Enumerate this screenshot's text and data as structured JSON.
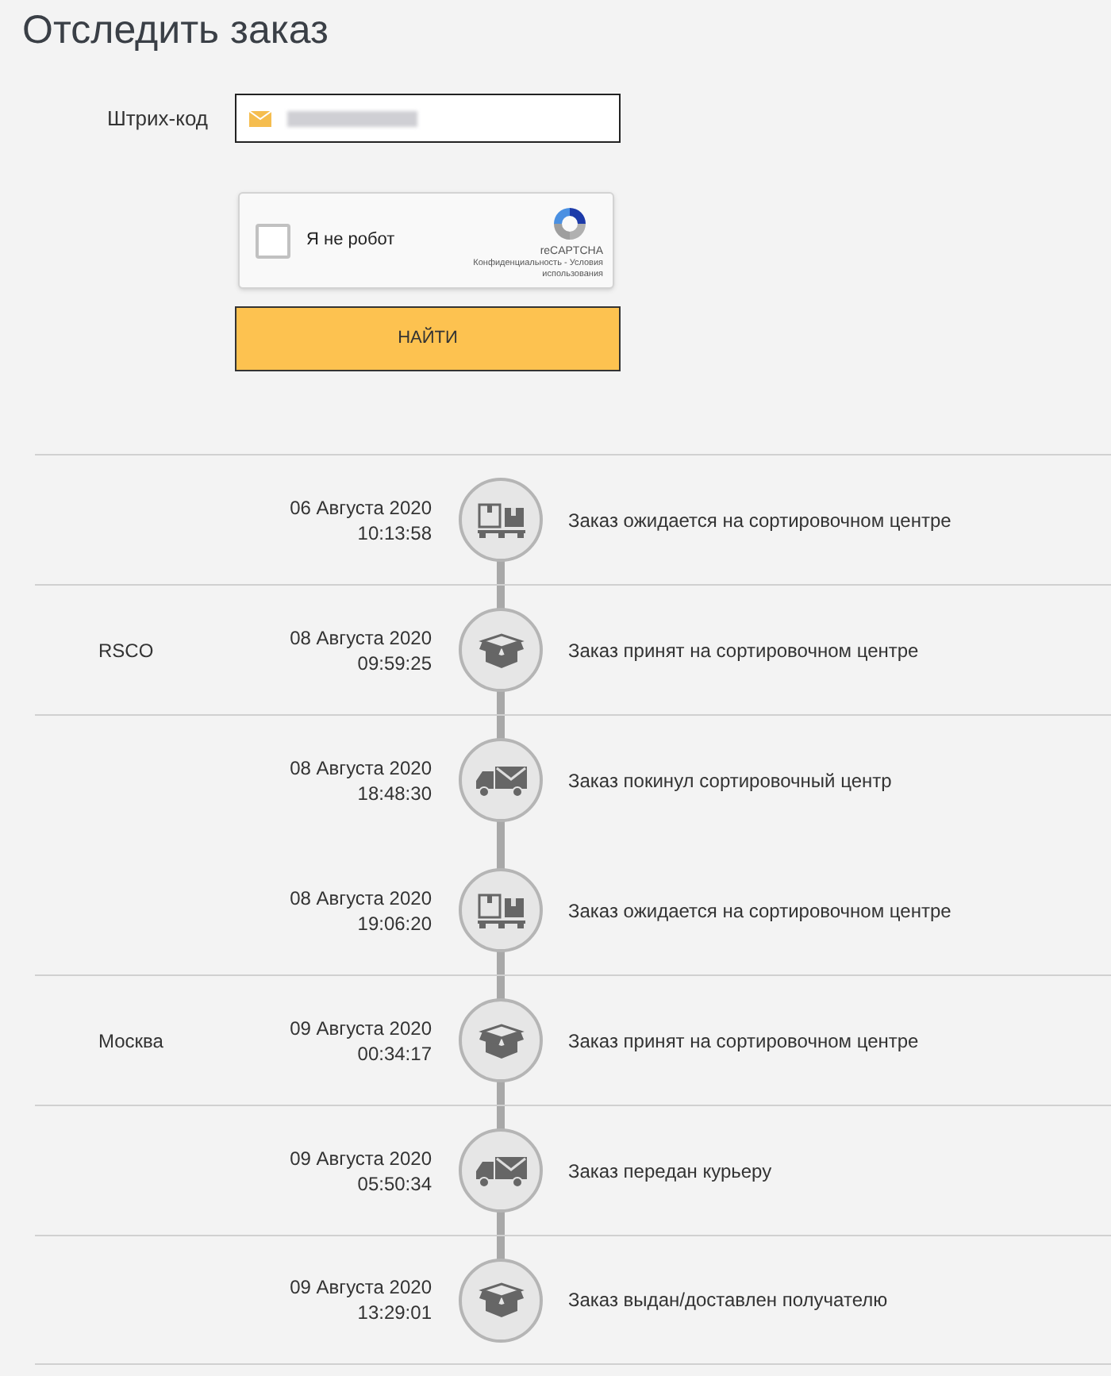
{
  "title": "Отследить заказ",
  "barcode": {
    "label": "Штрих-код"
  },
  "captcha": {
    "label": "Я не робот",
    "checked": false,
    "brand": "reCAPTCHA",
    "links": "Конфиденциальность - Условия использования"
  },
  "search_button": "НАЙТИ",
  "events": [
    {
      "date": "06 Августа 2020",
      "time": "10:13:58",
      "kind": "pallet",
      "status": "Заказ ожидается на сортировочном центре",
      "divider": true
    },
    {
      "location": "RSCO",
      "date": "08 Августа 2020",
      "time": "09:59:25",
      "kind": "box",
      "status": "Заказ принят на сортировочном центре",
      "divider": true
    },
    {
      "date": "08 Августа 2020",
      "time": "18:48:30",
      "kind": "truck",
      "status": "Заказ покинул сортировочный центр",
      "divider": true
    },
    {
      "date": "08 Августа 2020",
      "time": "19:06:20",
      "kind": "pallet",
      "status": "Заказ ожидается на сортировочном центре",
      "divider": false
    },
    {
      "location": "Москва",
      "date": "09 Августа 2020",
      "time": "00:34:17",
      "kind": "box",
      "status": "Заказ принят на сортировочном центре",
      "divider": true
    },
    {
      "date": "09 Августа 2020",
      "time": "05:50:34",
      "kind": "truck",
      "status": "Заказ передан курьеру",
      "divider": true
    },
    {
      "date": "09 Августа 2020",
      "time": "13:29:01",
      "kind": "box",
      "status": "Заказ выдан/доставлен получателю",
      "divider": true
    }
  ]
}
